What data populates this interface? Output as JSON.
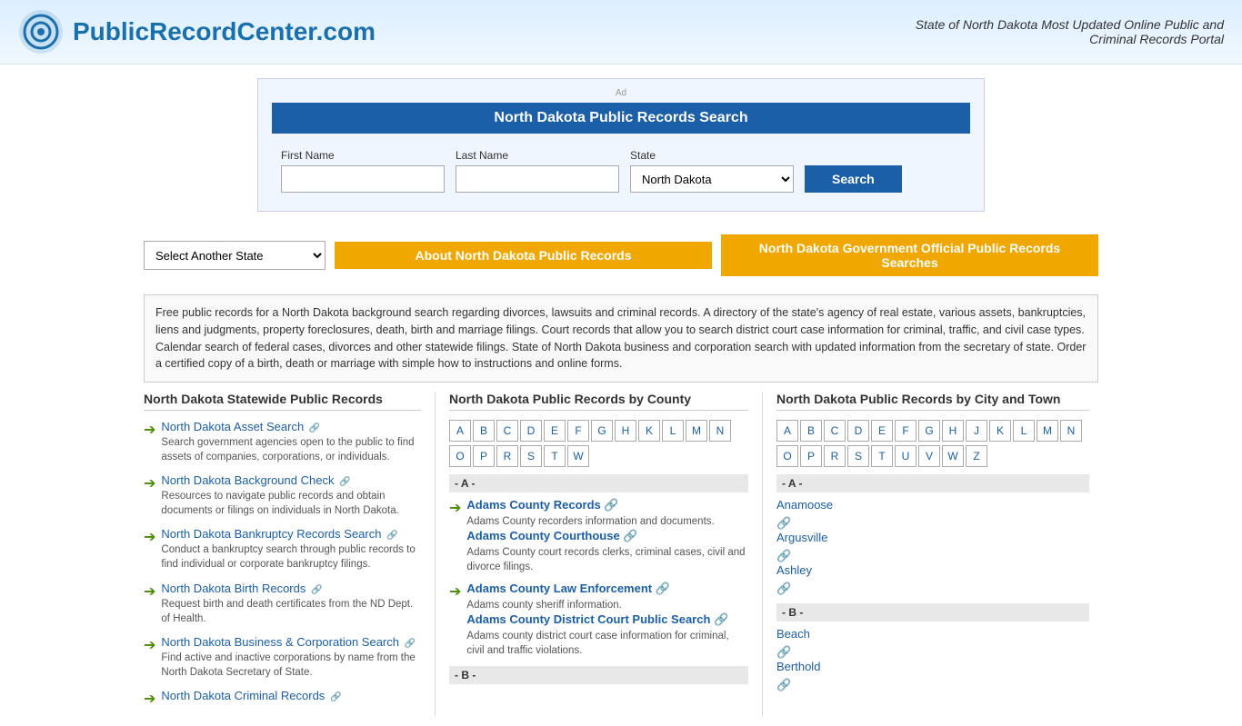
{
  "header": {
    "logo_text": "PublicRecordCenter.com",
    "tagline_line1": "State of North Dakota Most Updated Online Public and",
    "tagline_line2": "Criminal Records Portal"
  },
  "search_box": {
    "ad_label": "Ad",
    "title": "North Dakota Public Records Search",
    "first_name_label": "First Name",
    "last_name_label": "Last Name",
    "state_label": "State",
    "state_value": "North Dakota",
    "search_button": "Search"
  },
  "nav": {
    "select_state_label": "Select Another State",
    "about_button": "About North Dakota Public Records",
    "gov_button": "North Dakota Government Official Public Records Searches"
  },
  "description": "Free public records for a North Dakota background search regarding divorces, lawsuits and criminal records. A directory of the state's agency of real estate, various assets, bankruptcies, liens and judgments, property foreclosures, death, birth and marriage filings. Court records that allow you to search district court case information for criminal, traffic, and civil case types. Calendar search of federal cases, divorces and other statewide filings. State of North Dakota business and corporation search with updated information from the secretary of state. Order a certified copy of a birth, death or marriage with simple how to instructions and online forms.",
  "statewide": {
    "heading": "North Dakota Statewide Public Records",
    "items": [
      {
        "link": "North Dakota Asset Search",
        "desc": "Search government agencies open to the public to find assets of companies, corporations, or individuals."
      },
      {
        "link": "North Dakota Background Check",
        "desc": "Resources to navigate public records and obtain documents or filings on individuals in North Dakota."
      },
      {
        "link": "North Dakota Bankruptcy Records Search",
        "desc": "Conduct a bankruptcy search through public records to find individual or corporate bankruptcy filings."
      },
      {
        "link": "North Dakota Birth Records",
        "desc": "Request birth and death certificates from the ND Dept. of Health."
      },
      {
        "link": "North Dakota Business & Corporation Search",
        "desc": "Find active and inactive corporations by name from the North Dakota Secretary of State."
      },
      {
        "link": "North Dakota Criminal Records",
        "desc": ""
      }
    ]
  },
  "county": {
    "heading": "North Dakota Public Records by County",
    "letters_row1": [
      "A",
      "B",
      "C",
      "D",
      "E",
      "F",
      "G",
      "H",
      "K",
      "L",
      "M",
      "N"
    ],
    "letters_row2": [
      "O",
      "P",
      "R",
      "S",
      "T",
      "W"
    ],
    "section_a": "- A -",
    "items_a": [
      {
        "link": "Adams County Records",
        "desc": "Adams County recorders information and documents.",
        "sub_link": "Adams County Courthouse",
        "sub_desc": "Adams County court records clerks, criminal cases, civil and divorce filings."
      },
      {
        "link": "Adams County Law Enforcement",
        "desc": "Adams county sheriff information.",
        "sub_link": "Adams County District Court Public Search",
        "sub_desc": "Adams county district court case information for criminal, civil and traffic violations."
      }
    ],
    "section_b": "- B -"
  },
  "city": {
    "heading": "North Dakota Public Records by City and Town",
    "letters_row1": [
      "A",
      "B",
      "C",
      "D",
      "E",
      "F",
      "G",
      "H",
      "J",
      "K",
      "L",
      "M",
      "N"
    ],
    "letters_row2": [
      "O",
      "P",
      "R",
      "S",
      "T",
      "U",
      "V",
      "W",
      "Z"
    ],
    "section_a": "- A -",
    "items_a": [
      {
        "link": "Anamoose"
      },
      {
        "link": "Argusville"
      },
      {
        "link": "Ashley"
      }
    ],
    "section_b": "- B -",
    "items_b": [
      {
        "link": "Beach"
      },
      {
        "link": "Berthold"
      }
    ]
  }
}
